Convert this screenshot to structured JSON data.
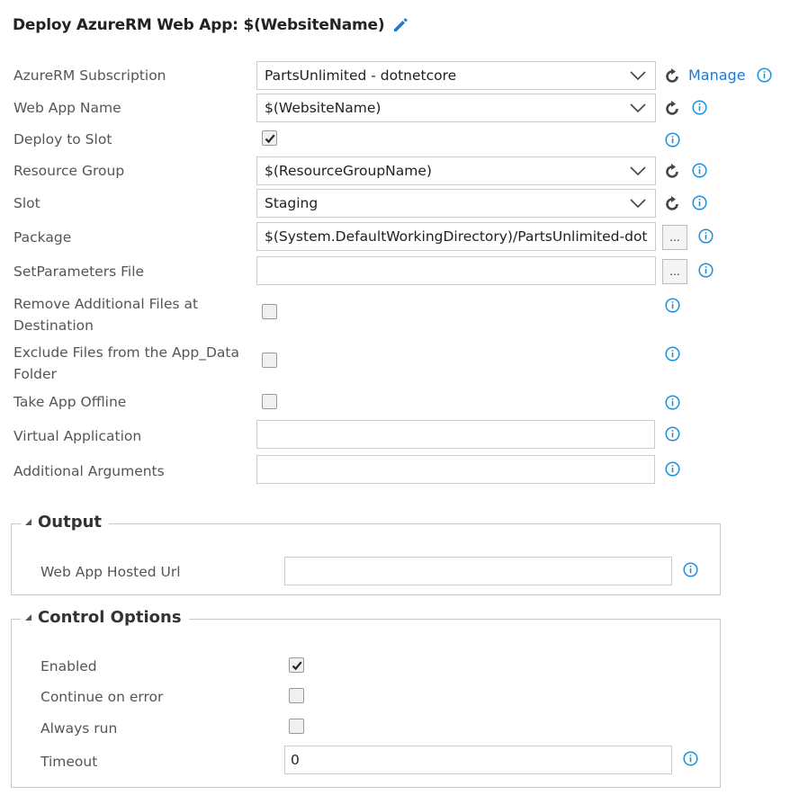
{
  "header": {
    "title": "Deploy AzureRM Web App: $(WebsiteName)",
    "edit_icon": "pencil-icon"
  },
  "fields": {
    "subscription": {
      "label": "AzureRM Subscription",
      "value": "PartsUnlimited - dotnetcore",
      "manage_label": "Manage"
    },
    "web_app_name": {
      "label": "Web App Name",
      "value": "$(WebsiteName)"
    },
    "deploy_to_slot": {
      "label": "Deploy to Slot",
      "checked": true
    },
    "resource_group": {
      "label": "Resource Group",
      "value": "$(ResourceGroupName)"
    },
    "slot": {
      "label": "Slot",
      "value": "Staging"
    },
    "package": {
      "label": "Package",
      "value": "$(System.DefaultWorkingDirectory)/PartsUnlimited-dot",
      "browse_label": "..."
    },
    "set_parameters_file": {
      "label": "SetParameters File",
      "value": "",
      "browse_label": "..."
    },
    "remove_additional_files": {
      "label": "Remove Additional Files at Destination",
      "checked": false
    },
    "exclude_app_data": {
      "label": "Exclude Files from the App_Data Folder",
      "checked": false
    },
    "take_app_offline": {
      "label": "Take App Offline",
      "checked": false
    },
    "virtual_application": {
      "label": "Virtual Application",
      "value": ""
    },
    "additional_arguments": {
      "label": "Additional Arguments",
      "value": ""
    }
  },
  "output": {
    "title": "Output",
    "web_app_hosted_url": {
      "label": "Web App Hosted Url",
      "value": ""
    }
  },
  "control_options": {
    "title": "Control Options",
    "enabled": {
      "label": "Enabled",
      "checked": true
    },
    "continue_on_error": {
      "label": "Continue on error",
      "checked": false
    },
    "always_run": {
      "label": "Always run",
      "checked": false
    },
    "timeout": {
      "label": "Timeout",
      "value": "0"
    }
  },
  "colors": {
    "accent": "#1f79c9",
    "info": "#1f8fd8",
    "text": "#555555",
    "border": "#cccccc"
  }
}
